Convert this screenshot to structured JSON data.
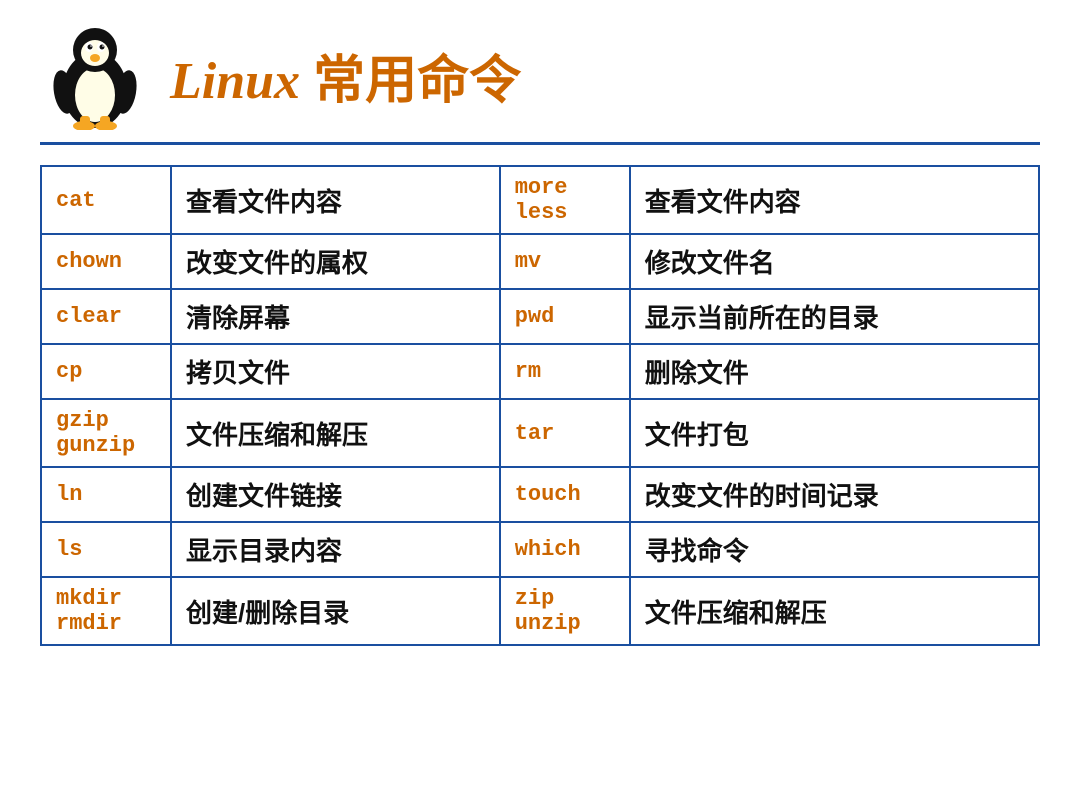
{
  "header": {
    "title_italic": "Linux",
    "title_rest": " 常用命令"
  },
  "table": {
    "rows": [
      {
        "cmd1": "cat",
        "desc1": "查看文件内容",
        "cmd2": "more\nless",
        "desc2": "查看文件内容"
      },
      {
        "cmd1": "chown",
        "desc1": "改变文件的属权",
        "cmd2": "mv",
        "desc2": "修改文件名"
      },
      {
        "cmd1": "clear",
        "desc1": "清除屏幕",
        "cmd2": "pwd",
        "desc2": "显示当前所在的目录"
      },
      {
        "cmd1": "cp",
        "desc1": "拷贝文件",
        "cmd2": "rm",
        "desc2": "删除文件"
      },
      {
        "cmd1": "gzip\ngunzip",
        "desc1": "文件压缩和解压",
        "cmd2": "tar",
        "desc2": "文件打包"
      },
      {
        "cmd1": "ln",
        "desc1": "创建文件链接",
        "cmd2": "touch",
        "desc2": "改变文件的时间记录"
      },
      {
        "cmd1": "ls",
        "desc1": "显示目录内容",
        "cmd2": "which",
        "desc2": "寻找命令"
      },
      {
        "cmd1": "mkdir\nrmdir",
        "desc1": "创建/删除目录",
        "cmd2": "zip\nunzip",
        "desc2": "文件压缩和解压"
      }
    ]
  }
}
